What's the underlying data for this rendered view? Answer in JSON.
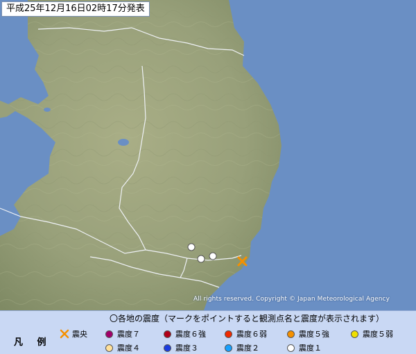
{
  "map": {
    "timestamp": "平成25年12月16日02時17分発表",
    "copyright": "All rights reserved. Copyright © Japan Meteorological Agency",
    "stations": [
      {
        "intensity": "1"
      },
      {
        "intensity": "1"
      },
      {
        "intensity": "1"
      }
    ],
    "epicenter_symbol": "✕"
  },
  "legend": {
    "heading": "凡 例",
    "description": "〇各地の震度（マークをポイントすると観測点名と震度が表示されます）",
    "epicenter_label": "震央",
    "items": [
      {
        "label": "震度７",
        "color": "#a0006a"
      },
      {
        "label": "震度６強",
        "color": "#b00018"
      },
      {
        "label": "震度６弱",
        "color": "#f02a00"
      },
      {
        "label": "震度５強",
        "color": "#f59000"
      },
      {
        "label": "震度５弱",
        "color": "#f0e000"
      },
      {
        "label": "震度４",
        "color": "#ffe09a"
      },
      {
        "label": "震度３",
        "color": "#1a3ce0"
      },
      {
        "label": "震度２",
        "color": "#16a0ff"
      },
      {
        "label": "震度１",
        "color": "#ffffff"
      }
    ],
    "epicenter_color": "#f59000"
  },
  "colors": {
    "sea": "#6a8fc4",
    "land": "#9aa37a",
    "border": "#e8ecf2"
  }
}
